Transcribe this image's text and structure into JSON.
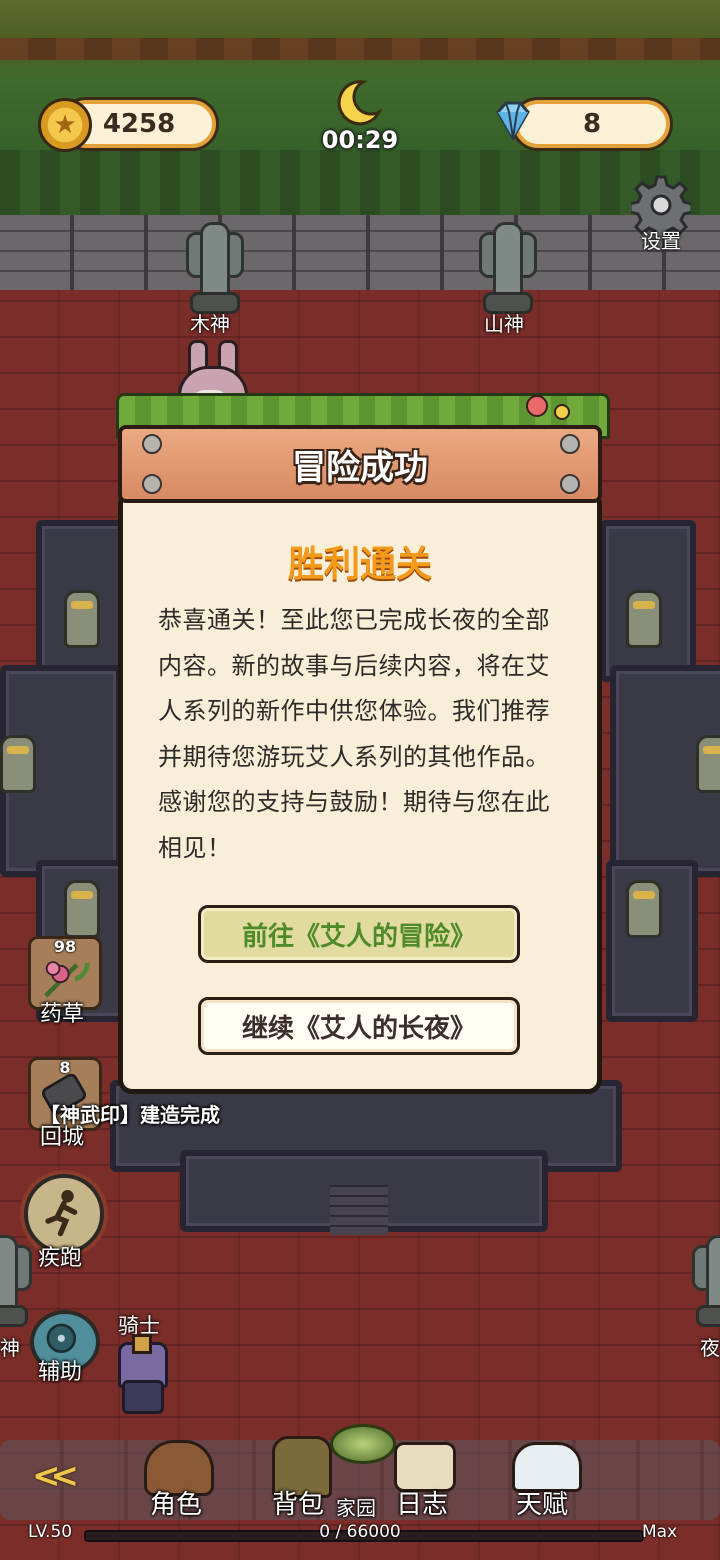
{
  "hud": {
    "coins": "4258",
    "timer": "00:29",
    "gems": "8",
    "settings_label": "设置"
  },
  "statues": {
    "left": "木神",
    "right": "山神",
    "far_left_partial": "神",
    "far_right_partial": "夜"
  },
  "side_items": [
    {
      "count": "98",
      "label": "药草",
      "icon": "herb-flower-icon"
    },
    {
      "count": "8",
      "label": "回城",
      "icon": "return-town-scroll-icon"
    }
  ],
  "side_buttons": {
    "sprint_label": "疾跑",
    "assist_label": "辅助"
  },
  "toast": "【神武印】建造完成",
  "character": {
    "name": "骑士"
  },
  "modal": {
    "title": "冒险成功",
    "subtitle": "胜利通关",
    "message": "恭喜通关！至此您已完成长夜的全部内容。新的故事与后续内容，将在艾人系列的新作中供您体验。我们推荐并期待您游玩艾人系列的其他作品。感谢您的支持与鼓励！期待与您在此相见！",
    "primary_button": "前往《艾人的冒险》",
    "secondary_button": "继续《艾人的长夜》"
  },
  "bottom_nav": {
    "back_label": "<<",
    "items": [
      "角色",
      "背包",
      "家园",
      "日志",
      "天赋"
    ]
  },
  "progress": {
    "level": "LV.50",
    "xp": "0 / 66000",
    "max": "Max",
    "fraction": 0
  },
  "colors": {
    "accent_orange": "#f39a1b",
    "primary_text_green": "#4f8a28",
    "panel_bg": "#f9efd8",
    "floor": "#7a2d29"
  }
}
